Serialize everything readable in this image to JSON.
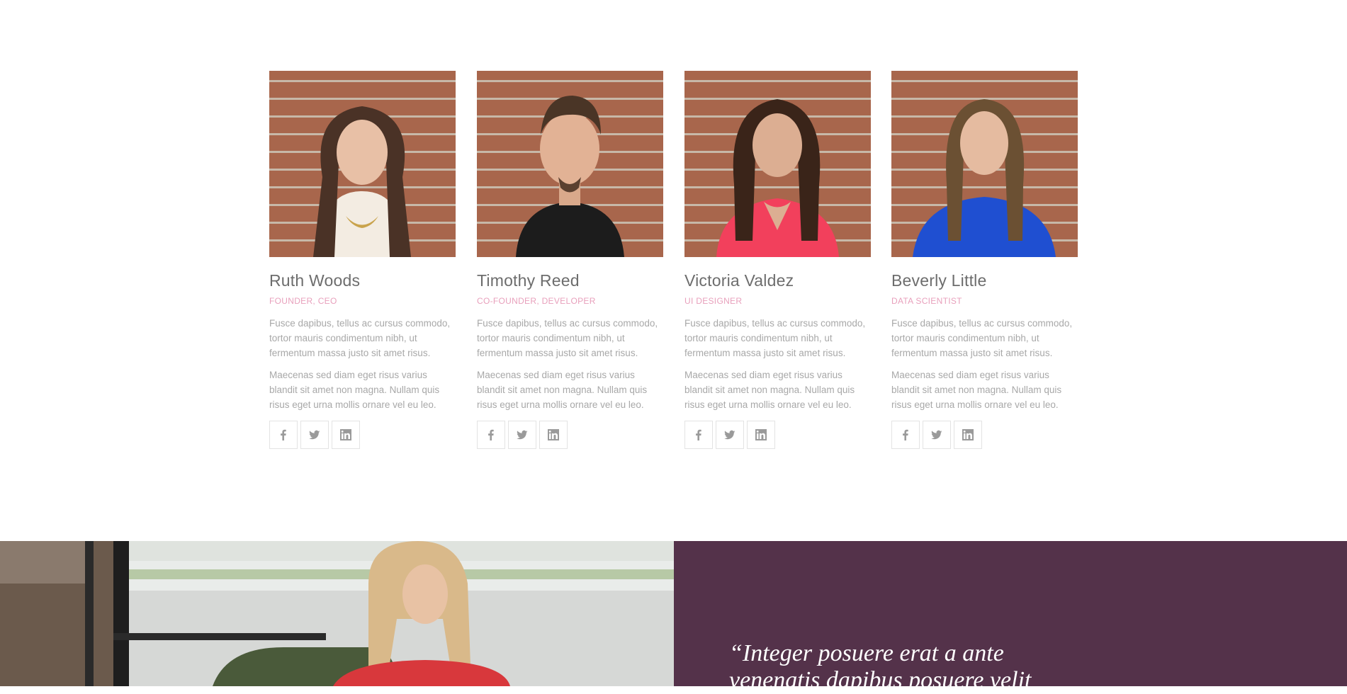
{
  "team": {
    "members": [
      {
        "name": "Ruth Woods",
        "role": "FOUNDER, CEO",
        "bio1": "Fusce dapibus, tellus ac cursus commodo, tortor mauris condimentum nibh, ut fermentum massa justo sit amet risus.",
        "bio2": "Maecenas sed diam eget risus varius blandit sit amet non magna. Nullam quis risus eget urna mollis ornare vel eu leo.",
        "photo_icon": "woman-portrait"
      },
      {
        "name": "Timothy Reed",
        "role": "CO-FOUNDER, DEVELOPER",
        "bio1": "Fusce dapibus, tellus ac cursus commodo, tortor mauris condimentum nibh, ut fermentum massa justo sit amet risus.",
        "bio2": "Maecenas sed diam eget risus varius blandit sit amet non magna. Nullam quis risus eget urna mollis ornare vel eu leo.",
        "photo_icon": "man-portrait"
      },
      {
        "name": "Victoria Valdez",
        "role": "UI DESIGNER",
        "bio1": "Fusce dapibus, tellus ac cursus commodo, tortor mauris condimentum nibh, ut fermentum massa justo sit amet risus.",
        "bio2": "Maecenas sed diam eget risus varius blandit sit amet non magna. Nullam quis risus eget urna mollis ornare vel eu leo.",
        "photo_icon": "woman-portrait"
      },
      {
        "name": "Beverly Little",
        "role": "DATA SCIENTIST",
        "bio1": "Fusce dapibus, tellus ac cursus commodo, tortor mauris condimentum nibh, ut fermentum massa justo sit amet risus.",
        "bio2": "Maecenas sed diam eget risus varius blandit sit amet non magna. Nullam quis risus eget urna mollis ornare vel eu leo.",
        "photo_icon": "woman-portrait"
      }
    ],
    "social_icons": [
      "facebook-icon",
      "twitter-icon",
      "linkedin-icon"
    ]
  },
  "testimonial": {
    "quote": "“Integer posuere erat a ante venenatis dapibus posuere velit"
  },
  "colors": {
    "role_accent": "#e8a0bc",
    "quote_bg": "#54324a",
    "name_text": "#6d6d6d",
    "body_text": "#a8a8a8"
  }
}
